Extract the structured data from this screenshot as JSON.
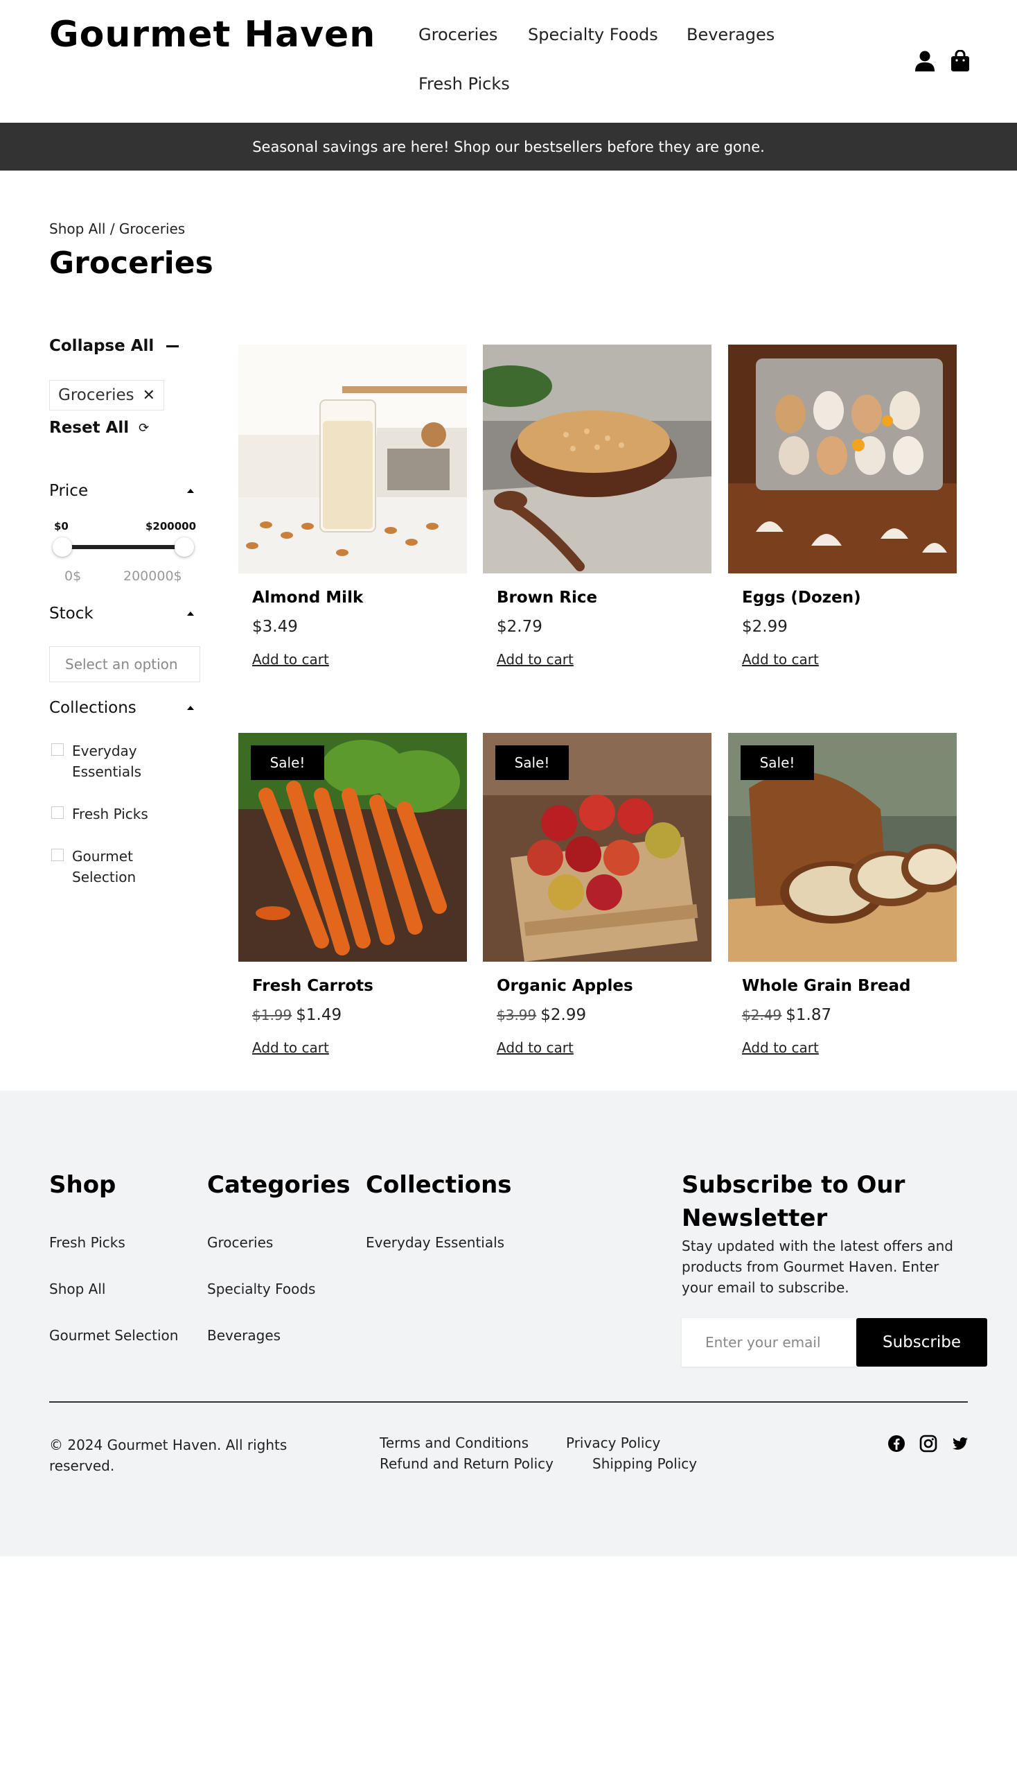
{
  "brand": {
    "name": "Gourmet Haven"
  },
  "nav": {
    "items": [
      {
        "label": "Groceries"
      },
      {
        "label": "Specialty Foods"
      },
      {
        "label": "Beverages"
      },
      {
        "label": "Fresh Picks"
      }
    ],
    "icons": [
      "user-icon",
      "shopping-bag-icon"
    ]
  },
  "promo": {
    "text": "Seasonal savings are here! Shop our bestsellers before they are gone."
  },
  "page": {
    "breadcrumb": "Shop All / Groceries",
    "title": "Groceries"
  },
  "filters": {
    "collapse_all": "Collapse All",
    "active_chip": "Groceries",
    "reset_all": "Reset All",
    "price": {
      "label": "Price",
      "min_label": "$0",
      "max_label": "$200000",
      "min_input": "0$",
      "max_input": "200000$"
    },
    "stock": {
      "label": "Stock",
      "placeholder": "Select an option"
    },
    "collections": {
      "label": "Collections",
      "options": [
        "Everyday Essentials",
        "Fresh Picks",
        "Gourmet Selection"
      ]
    }
  },
  "products": [
    {
      "name": "Almond Milk",
      "price": "$3.49",
      "old_price": "",
      "sale": false,
      "cart": "Add to cart",
      "image": "almond-milk-glass"
    },
    {
      "name": "Brown Rice",
      "price": "$2.79",
      "old_price": "",
      "sale": false,
      "cart": "Add to cart",
      "image": "rice-bowl"
    },
    {
      "name": "Eggs (Dozen)",
      "price": "$2.99",
      "old_price": "",
      "sale": false,
      "cart": "Add to cart",
      "image": "egg-carton"
    },
    {
      "name": "Fresh Carrots",
      "price": "$1.49",
      "old_price": "$1.99",
      "sale": true,
      "sale_label": "Sale!",
      "cart": "Add to cart",
      "image": "carrots"
    },
    {
      "name": "Organic Apples",
      "price": "$2.99",
      "old_price": "$3.99",
      "sale": true,
      "sale_label": "Sale!",
      "cart": "Add to cart",
      "image": "apple-crate"
    },
    {
      "name": "Whole Grain Bread",
      "price": "$1.87",
      "old_price": "$2.49",
      "sale": true,
      "sale_label": "Sale!",
      "cart": "Add to cart",
      "image": "bread-loaf"
    }
  ],
  "footer": {
    "shop": {
      "title": "Shop",
      "links": [
        "Fresh Picks",
        "Shop All",
        "Gourmet Selection"
      ]
    },
    "categories": {
      "title": "Categories",
      "links": [
        "Groceries",
        "Specialty Foods",
        "Beverages"
      ]
    },
    "collections": {
      "title": "Collections",
      "links": [
        "Everyday Essentials"
      ]
    },
    "newsletter": {
      "title": "Subscribe to Our Newsletter",
      "text": "Stay updated with the latest offers and products from Gourmet Haven. Enter your email to subscribe.",
      "placeholder": "Enter your email",
      "button": "Subscribe"
    },
    "copyright": "© 2024 Gourmet Haven. All rights reserved.",
    "legal": [
      "Terms and Conditions",
      "Privacy Policy",
      "Refund and Return Policy",
      "Shipping Policy"
    ],
    "social": [
      "facebook-icon",
      "instagram-icon",
      "twitter-icon"
    ]
  },
  "colors": {
    "promo_bg": "#333333",
    "footer_bg": "#f2f3f5",
    "accent": "#000000"
  }
}
